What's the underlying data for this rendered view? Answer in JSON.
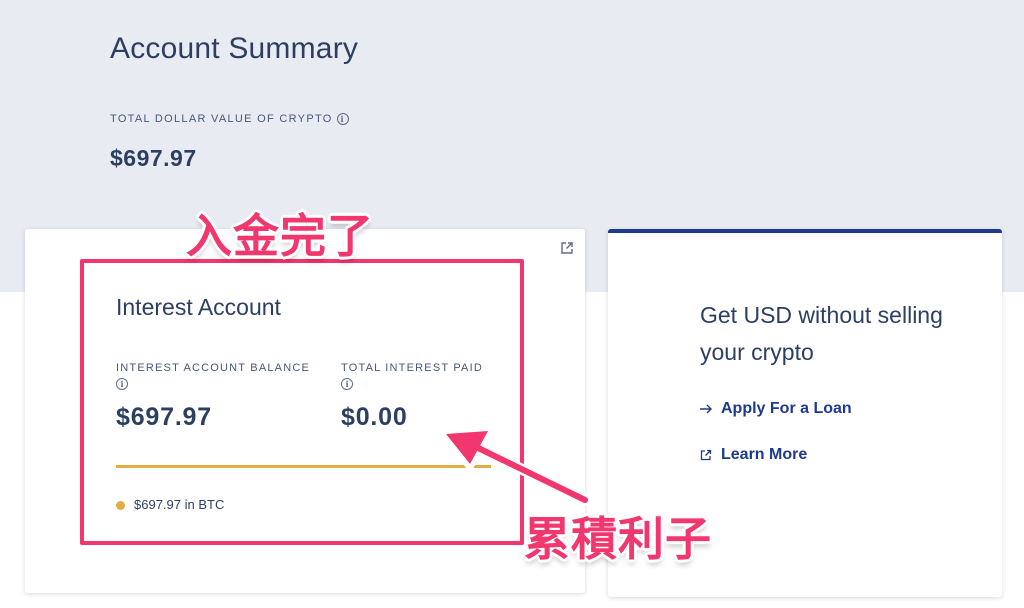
{
  "header": {
    "title": "Account Summary",
    "total_label": "TOTAL DOLLAR VALUE OF CRYPTO",
    "total_value": "$697.97"
  },
  "interest_card": {
    "title": "Interest Account",
    "balance_label": "INTEREST ACCOUNT BALANCE",
    "balance_value": "$697.97",
    "paid_label": "TOTAL INTEREST PAID",
    "paid_value": "$0.00",
    "asset_line": "$697.97 in BTC",
    "progress_fraction": 1.0
  },
  "loan_card": {
    "title": "Get USD without selling your crypto",
    "apply_label": "Apply For a Loan",
    "learn_label": "Learn More"
  },
  "annotations": {
    "deposit_done": "入金完了",
    "accrued_interest": "累積利子"
  },
  "colors": {
    "accent_gold": "#e3ad45",
    "brand_blue": "#1e3a8a",
    "annotation_pink": "#f2366e",
    "band_gray": "#e9ebf2"
  },
  "icons": {
    "info": "info-icon",
    "external_link": "external-link-icon",
    "arrow_right": "arrow-right-icon"
  }
}
